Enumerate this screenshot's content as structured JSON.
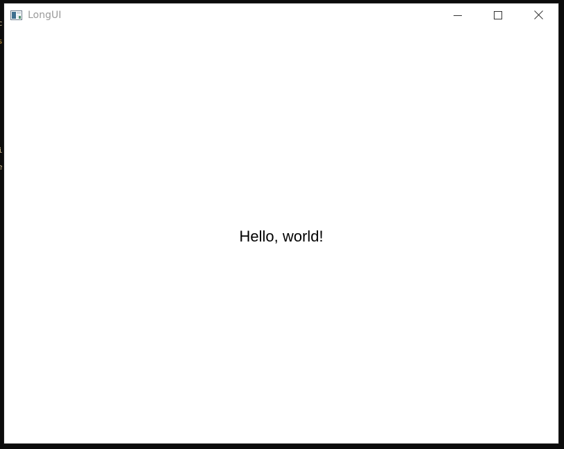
{
  "window": {
    "title": "LongUI",
    "icon": "app-window-icon",
    "caption_buttons": {
      "minimize_icon": "minimize-icon",
      "maximize_icon": "maximize-icon",
      "close_icon": "close-icon"
    }
  },
  "client": {
    "message": "Hello, world!"
  },
  "background_edge_chars": [
    {
      "char": "c",
      "color": "#c8b48a"
    },
    {
      "char": "s",
      "color": "#c89a3a"
    },
    {
      "char": "i",
      "color": "#c8b48a"
    },
    {
      "char": "e",
      "color": "#c8b48a"
    }
  ],
  "colors": {
    "window_background": "#ffffff",
    "title_text": "#9a9a9a",
    "frame": "#000000",
    "text": "#000000"
  }
}
